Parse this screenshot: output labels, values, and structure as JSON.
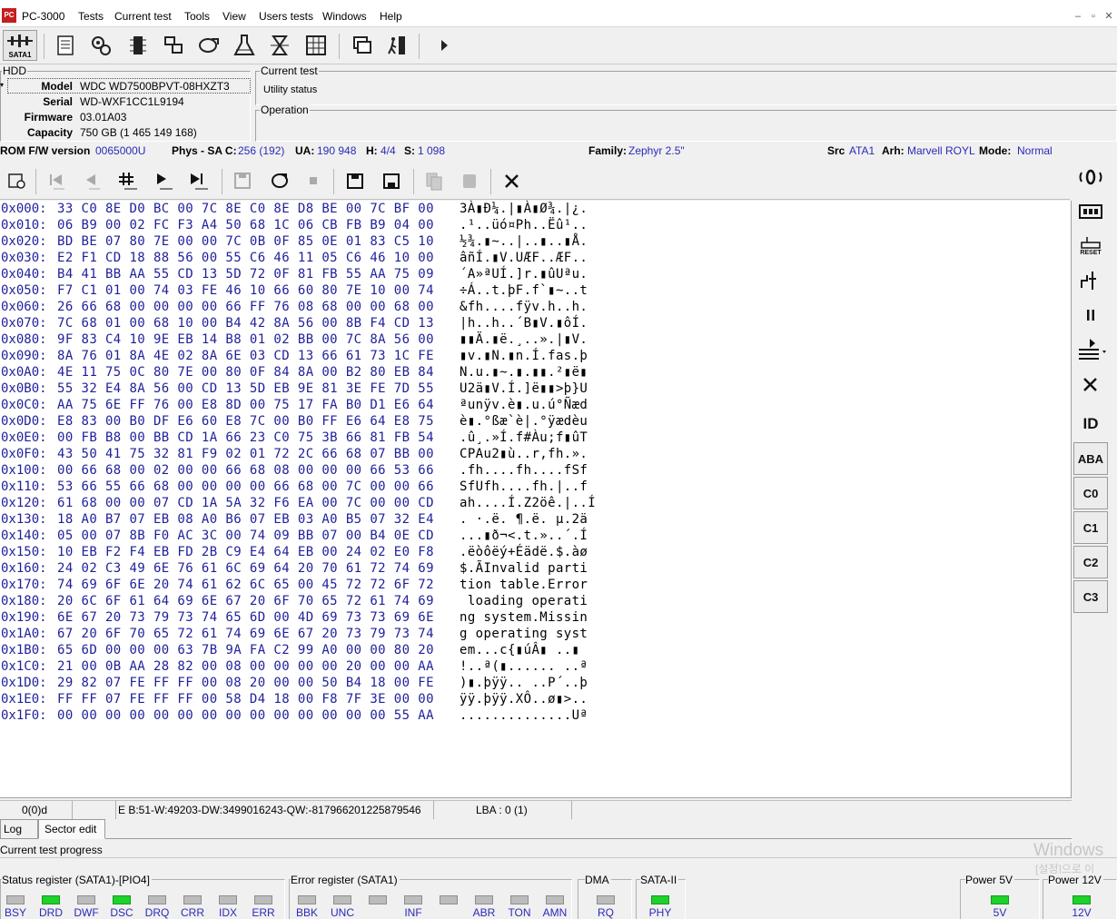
{
  "app": {
    "title": "PC-3000",
    "icon_label": "PC"
  },
  "menu": {
    "items": [
      "Tests",
      "Current test",
      "Tools",
      "View",
      "Users tests",
      "Windows",
      "Help"
    ]
  },
  "toolbar": {
    "sata_label": "SATA1"
  },
  "hdd": {
    "group_label": "HDD",
    "model_label": "Model",
    "model": "WDC WD7500BPVT-08HXZT3",
    "serial_label": "Serial",
    "serial": "WD-WXF1CC1L9194",
    "firmware_label": "Firmware",
    "firmware": "03.01A03",
    "capacity_label": "Capacity",
    "capacity": "750 GB (1 465 149 168)"
  },
  "current_test": {
    "group_label": "Current test",
    "status": "Utility status"
  },
  "operation": {
    "group_label": "Operation"
  },
  "info_strip": {
    "rom_label": "ROM F/W version",
    "rom": "0065000U",
    "phys_label": "Phys - SA C:",
    "phys": "256 (192)",
    "ua_label": "UA:",
    "ua": "190 948",
    "h_label": "H:",
    "h": "4/4",
    "s_label": "S:",
    "s": "1 098",
    "family_label": "Family:",
    "family": "Zephyr 2.5\"",
    "src_label": "Src",
    "src": "ATA1",
    "arh_label": "Arh:",
    "arh": "Marvell ROYL",
    "mode_label": "Mode:",
    "mode": "Normal"
  },
  "hex": {
    "rows": [
      {
        "addr": "0x000:",
        "bytes": "33 C0 8E D0 BC 00 7C 8E C0 8E D8 BE 00 7C BF 00",
        "ascii": "3À▮Ð¼.|▮À▮Ø¾.|¿."
      },
      {
        "addr": "0x010:",
        "bytes": "06 B9 00 02 FC F3 A4 50 68 1C 06 CB FB B9 04 00",
        "ascii": ".¹..üó¤Ph..Ëû¹.."
      },
      {
        "addr": "0x020:",
        "bytes": "BD BE 07 80 7E 00 00 7C 0B 0F 85 0E 01 83 C5 10",
        "ascii": "½¾.▮~..|..▮..▮Å."
      },
      {
        "addr": "0x030:",
        "bytes": "E2 F1 CD 18 88 56 00 55 C6 46 11 05 C6 46 10 00",
        "ascii": "âñÍ.▮V.UÆF..ÆF.."
      },
      {
        "addr": "0x040:",
        "bytes": "B4 41 BB AA 55 CD 13 5D 72 0F 81 FB 55 AA 75 09",
        "ascii": "´A»ªUÍ.]r.▮ûUªu."
      },
      {
        "addr": "0x050:",
        "bytes": "F7 C1 01 00 74 03 FE 46 10 66 60 80 7E 10 00 74",
        "ascii": "÷Á..t.þF.f`▮~..t"
      },
      {
        "addr": "0x060:",
        "bytes": "26 66 68 00 00 00 00 66 FF 76 08 68 00 00 68 00",
        "ascii": "&fh....fÿv.h..h."
      },
      {
        "addr": "0x070:",
        "bytes": "7C 68 01 00 68 10 00 B4 42 8A 56 00 8B F4 CD 13",
        "ascii": "|h..h..´B▮V.▮ôÍ."
      },
      {
        "addr": "0x080:",
        "bytes": "9F 83 C4 10 9E EB 14 B8 01 02 BB 00 7C 8A 56 00",
        "ascii": "▮▮Ä.▮ë.¸..».|▮V."
      },
      {
        "addr": "0x090:",
        "bytes": "8A 76 01 8A 4E 02 8A 6E 03 CD 13 66 61 73 1C FE",
        "ascii": "▮v.▮N.▮n.Í.fas.þ"
      },
      {
        "addr": "0x0A0:",
        "bytes": "4E 11 75 0C 80 7E 00 80 0F 84 8A 00 B2 80 EB 84",
        "ascii": "N.u.▮~.▮.▮▮.²▮ë▮"
      },
      {
        "addr": "0x0B0:",
        "bytes": "55 32 E4 8A 56 00 CD 13 5D EB 9E 81 3E FE 7D 55",
        "ascii": "U2ä▮V.Í.]ë▮▮>þ}U"
      },
      {
        "addr": "0x0C0:",
        "bytes": "AA 75 6E FF 76 00 E8 8D 00 75 17 FA B0 D1 E6 64",
        "ascii": "ªunÿv.è▮.u.ú°Ñæd"
      },
      {
        "addr": "0x0D0:",
        "bytes": "E8 83 00 B0 DF E6 60 E8 7C 00 B0 FF E6 64 E8 75",
        "ascii": "è▮.°ßæ`è|.°ÿædèu"
      },
      {
        "addr": "0x0E0:",
        "bytes": "00 FB B8 00 BB CD 1A 66 23 C0 75 3B 66 81 FB 54",
        "ascii": ".û¸.»Í.f#Àu;f▮ûT"
      },
      {
        "addr": "0x0F0:",
        "bytes": "43 50 41 75 32 81 F9 02 01 72 2C 66 68 07 BB 00",
        "ascii": "CPAu2▮ù..r,fh.»."
      },
      {
        "addr": "0x100:",
        "bytes": "00 66 68 00 02 00 00 66 68 08 00 00 00 66 53 66",
        "ascii": ".fh....fh....fSf"
      },
      {
        "addr": "0x110:",
        "bytes": "53 66 55 66 68 00 00 00 00 66 68 00 7C 00 00 66",
        "ascii": "SfUfh....fh.|..f"
      },
      {
        "addr": "0x120:",
        "bytes": "61 68 00 00 07 CD 1A 5A 32 F6 EA 00 7C 00 00 CD",
        "ascii": "ah....Í.Z2öê.|..Í"
      },
      {
        "addr": "0x130:",
        "bytes": "18 A0 B7 07 EB 08 A0 B6 07 EB 03 A0 B5 07 32 E4",
        "ascii": ". ·.ë. ¶.ë. µ.2ä"
      },
      {
        "addr": "0x140:",
        "bytes": "05 00 07 8B F0 AC 3C 00 74 09 BB 07 00 B4 0E CD",
        "ascii": "...▮ð¬<.t.»..´.Í"
      },
      {
        "addr": "0x150:",
        "bytes": "10 EB F2 F4 EB FD 2B C9 E4 64 EB 00 24 02 E0 F8",
        "ascii": ".ëòôëý+Éädë.$.àø"
      },
      {
        "addr": "0x160:",
        "bytes": "24 02 C3 49 6E 76 61 6C 69 64 20 70 61 72 74 69",
        "ascii": "$.ÃInvalid parti"
      },
      {
        "addr": "0x170:",
        "bytes": "74 69 6F 6E 20 74 61 62 6C 65 00 45 72 72 6F 72",
        "ascii": "tion table.Error"
      },
      {
        "addr": "0x180:",
        "bytes": "20 6C 6F 61 64 69 6E 67 20 6F 70 65 72 61 74 69",
        "ascii": " loading operati"
      },
      {
        "addr": "0x190:",
        "bytes": "6E 67 20 73 79 73 74 65 6D 00 4D 69 73 73 69 6E",
        "ascii": "ng system.Missin"
      },
      {
        "addr": "0x1A0:",
        "bytes": "67 20 6F 70 65 72 61 74 69 6E 67 20 73 79 73 74",
        "ascii": "g operating syst"
      },
      {
        "addr": "0x1B0:",
        "bytes": "65 6D 00 00 00 63 7B 9A FA C2 99 A0 00 00 80 20",
        "ascii": "em...c{▮úÂ▮ ..▮ "
      },
      {
        "addr": "0x1C0:",
        "bytes": "21 00 0B AA 28 82 00 08 00 00 00 00 20 00 00 AA",
        "ascii": "!..ª(▮...... ..ª"
      },
      {
        "addr": "0x1D0:",
        "bytes": "29 82 07 FE FF FF 00 08 20 00 00 50 B4 18 00 FE",
        "ascii": ")▮.þÿÿ.. ..P´..þ"
      },
      {
        "addr": "0x1E0:",
        "bytes": "FF FF 07 FE FF FF 00 58 D4 18 00 F8 7F 3E 00 00",
        "ascii": "ÿÿ.þÿÿ.XÔ..ø▮>.."
      },
      {
        "addr": "0x1F0:",
        "bytes": "00 00 00 00 00 00 00 00 00 00 00 00 00 00 55 AA",
        "ascii": "..............Uª"
      }
    ]
  },
  "right_bar": {
    "id_label": "ID",
    "aba_label": "ABA",
    "c0_label": "C0",
    "c1_label": "C1",
    "c2_label": "C2",
    "c3_label": "C3",
    "reset_label": "RESET"
  },
  "statusbar": {
    "position": "0(0)d",
    "values": "E B:51-W:49203-DW:3499016243-QW:-817966201225879546",
    "lba": "LBA : 0 (1)"
  },
  "tabs": {
    "log": "Log",
    "sector_edit": "Sector edit"
  },
  "progress": {
    "label": "Current test progress"
  },
  "registers": {
    "status_title": "Status register (SATA1)-[PIO4]",
    "status_leds": [
      {
        "label": "BSY",
        "on": false
      },
      {
        "label": "DRD",
        "on": true
      },
      {
        "label": "DWF",
        "on": false
      },
      {
        "label": "DSC",
        "on": true
      },
      {
        "label": "DRQ",
        "on": false
      },
      {
        "label": "CRR",
        "on": false
      },
      {
        "label": "IDX",
        "on": false
      },
      {
        "label": "ERR",
        "on": false
      }
    ],
    "error_title": "Error register (SATA1)",
    "error_leds": [
      {
        "label": "BBK",
        "on": false
      },
      {
        "label": "UNC",
        "on": false
      },
      {
        "label": "",
        "on": false
      },
      {
        "label": "INF",
        "on": false
      },
      {
        "label": "",
        "on": false
      },
      {
        "label": "ABR",
        "on": false
      },
      {
        "label": "TON",
        "on": false
      },
      {
        "label": "AMN",
        "on": false
      }
    ],
    "dma_title": "DMA",
    "dma_led": {
      "label": "RQ",
      "on": false
    },
    "sata_title": "SATA-II",
    "sata_led": {
      "label": "PHY",
      "on": true
    },
    "power5_title": "Power 5V",
    "power5_led": {
      "label": "5V",
      "on": true
    },
    "power12_title": "Power 12V",
    "power12_led": {
      "label": "12V",
      "on": true
    }
  },
  "watermark": {
    "line1": "Windows",
    "line2": "[설정]으로 이"
  },
  "colors": {
    "led_on": "#1ed12b",
    "led_off": "#bcbcbc",
    "value_blue": "#2a2ab8",
    "hex_blue": "#1f1f9a"
  }
}
